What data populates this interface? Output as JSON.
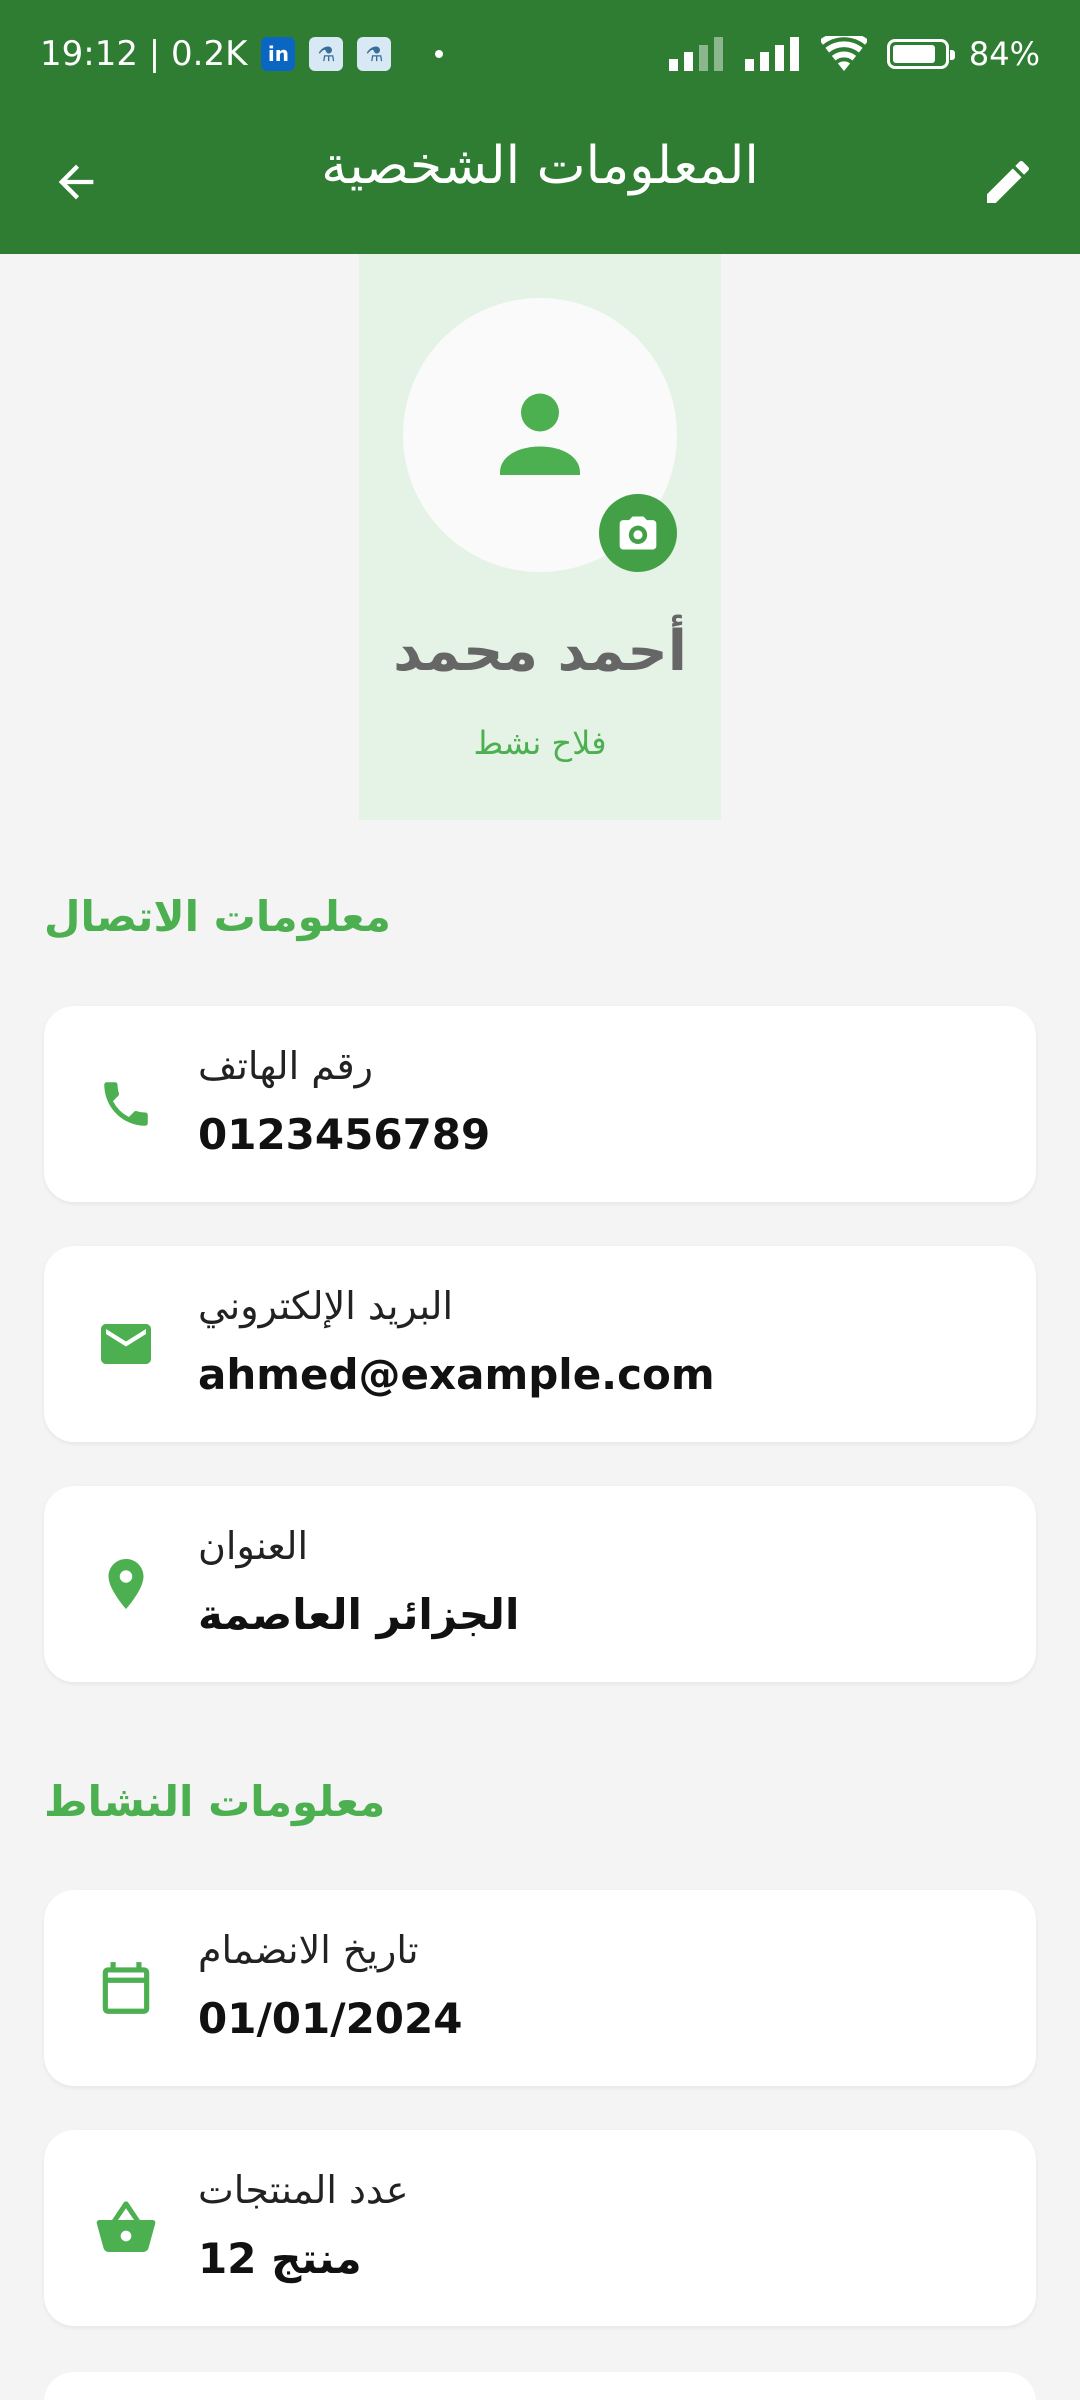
{
  "status_bar": {
    "time_and_speed": "19:12 | 0.2K",
    "battery": "84%",
    "battery_level": 0.84
  },
  "app_bar": {
    "title": "المعلومات الشخصية",
    "back_icon": "arrow-back-icon",
    "edit_icon": "edit-pencil-icon"
  },
  "profile": {
    "name": "أحمد محمد",
    "role": "فلاح نشط",
    "avatar_icon": "person-icon",
    "camera_icon": "camera-icon"
  },
  "contact_section": {
    "title": "معلومات الاتصال",
    "items": [
      {
        "label": "رقم الهاتف",
        "value": "0123456789",
        "icon": "phone-icon"
      },
      {
        "label": "البريد الإلكتروني",
        "value": "ahmed@example.com",
        "icon": "email-icon"
      },
      {
        "label": "العنوان",
        "value": "الجزائر العاصمة",
        "icon": "location-icon"
      }
    ]
  },
  "activity_section": {
    "title": "معلومات النشاط",
    "items": [
      {
        "label": "تاريخ الانضمام",
        "value": "01/01/2024",
        "icon": "calendar-icon"
      },
      {
        "label": "عدد المنتجات",
        "value": "12 منتج",
        "icon": "basket-icon"
      }
    ]
  },
  "colors": {
    "primary_dark": "#2e7d32",
    "accent": "#4caf50",
    "panel_tint": "#e4f3e5",
    "background": "#f4f4f4"
  }
}
